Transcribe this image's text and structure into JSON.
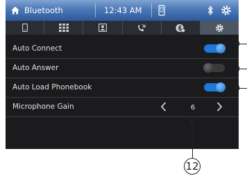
{
  "header": {
    "title": "Bluetooth",
    "time": "12:43 AM",
    "home_icon": "home-icon",
    "phone_status_icon": "phone-status-icon",
    "bluetooth_icon": "bluetooth-icon",
    "settings_icon": "settings-icon"
  },
  "tabs": [
    {
      "icon": "phone-icon",
      "active": false
    },
    {
      "icon": "keypad-icon",
      "active": false
    },
    {
      "icon": "contacts-icon",
      "active": false
    },
    {
      "icon": "call-log-icon",
      "active": false
    },
    {
      "icon": "bluetooth-audio-icon",
      "active": false
    },
    {
      "icon": "settings-icon",
      "active": true
    }
  ],
  "settings": {
    "auto_connect": {
      "label": "Auto Connect",
      "enabled": true
    },
    "auto_answer": {
      "label": "Auto Answer",
      "enabled": false
    },
    "auto_load_phonebook": {
      "label": "Auto Load Phonebook",
      "enabled": true
    },
    "microphone_gain": {
      "label": "Microphone Gain",
      "value": "6"
    }
  },
  "callout": {
    "number": "12"
  },
  "colors": {
    "header": "#4b78b6",
    "toggle_on": "#1d78d8",
    "toggle_off": "#3a3a3a",
    "background": "#1b1b1d"
  }
}
